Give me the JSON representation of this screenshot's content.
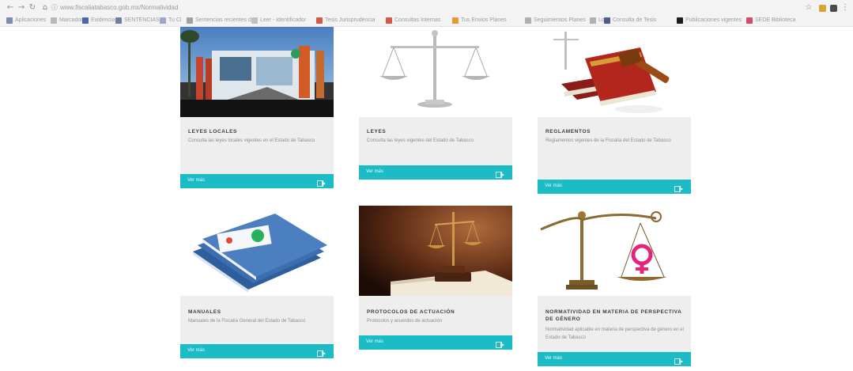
{
  "browser": {
    "url": "www.fiscaliatabasco.gob.mx/Normatividad",
    "bookmarks": [
      {
        "label": "Aplicaciones",
        "color": "#7c8cb0"
      },
      {
        "label": "Marcadores",
        "color": "#b8b8b8"
      },
      {
        "label": "Evidencia",
        "color": "#4a67a8"
      },
      {
        "label": "SENTENCIAS",
        "color": "#6f7f9f"
      },
      {
        "label": "Tu Cl",
        "color": "#9ba8c8"
      },
      {
        "label": "Sentencias recientes de",
        "color": "#a1a1a1"
      },
      {
        "label": "Leer - Identificador",
        "color": "#c0c0c0"
      },
      {
        "label": "Tesis Jurisprudencia",
        "color": "#d35a4a"
      },
      {
        "label": "Consultas Internas",
        "color": "#d35a4a"
      },
      {
        "label": "Tus Envios Planes",
        "color": "#e39a3a"
      },
      {
        "label": "Seguimientos Planes",
        "color": "#b0b0b0"
      },
      {
        "label": "Lo",
        "color": "#b0b0b0"
      },
      {
        "label": "Consulta de Tesis",
        "color": "#4c5f8f"
      },
      {
        "label": "Publicaciones vigentes",
        "color": "#1e1e1e"
      },
      {
        "label": "SEDE Biblioteca",
        "color": "#d14b6a"
      }
    ]
  },
  "cards": [
    {
      "title": "LEYES LOCALES",
      "desc": "Consulta las leyes locales vigentes en el Estado de Tabasco",
      "button": "Ver más"
    },
    {
      "title": "LEYES",
      "desc": "Consulta las leyes vigentes del Estado de Tabasco",
      "button": "Ver más"
    },
    {
      "title": "REGLAMENTOS",
      "desc": "Reglamentos vigentes de la Fiscalía del Estado de Tabasco",
      "button": "Ver más"
    },
    {
      "title": "MANUALES",
      "desc": "Manuales de la Fiscalía General del Estado de Tabasco",
      "button": "Ver más"
    },
    {
      "title": "PROTOCOLOS DE ACTUACIÓN",
      "desc": "Protocolos y acuerdos de actuación",
      "button": "Ver más"
    },
    {
      "title": "NORMATIVIDAD EN MATERIA DE PERSPECTIVA DE GÉNERO",
      "desc": "Normatividad aplicable en materia de perspectiva de género en el Estado de Tabasco",
      "button": "Ver más"
    }
  ],
  "colors": {
    "accent": "#1bbcc6",
    "card_bg": "#eeeeef"
  }
}
